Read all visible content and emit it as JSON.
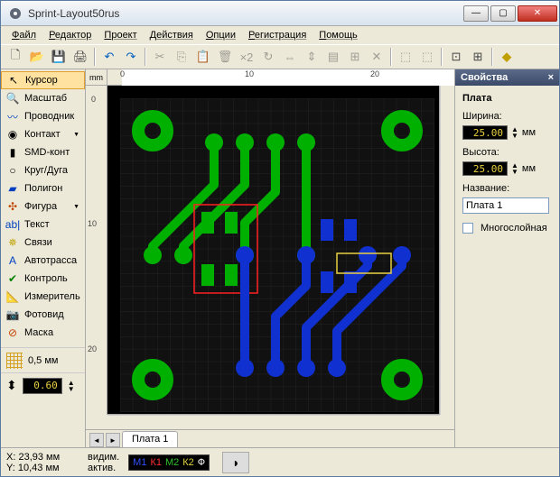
{
  "window": {
    "title": "Sprint-Layout50rus"
  },
  "menu": [
    "Файл",
    "Редактор",
    "Проект",
    "Действия",
    "Опции",
    "Регистрация",
    "Помощь"
  ],
  "tools": {
    "items": [
      {
        "icon": "↖",
        "label": "Курсор",
        "sel": true,
        "color": "#000"
      },
      {
        "icon": "🔍",
        "label": "Масштаб",
        "color": "#000"
      },
      {
        "icon": "〰",
        "label": "Проводник",
        "color": "#0040c0"
      },
      {
        "icon": "◉",
        "label": "Контакт",
        "color": "#000",
        "arrow": true
      },
      {
        "icon": "▮",
        "label": "SMD-конт",
        "color": "#000"
      },
      {
        "icon": "○",
        "label": "Круг/Дуга",
        "color": "#000"
      },
      {
        "icon": "▰",
        "label": "Полигон",
        "color": "#0040c0"
      },
      {
        "icon": "✣",
        "label": "Фигура",
        "color": "#c04000",
        "arrow": true
      },
      {
        "icon": "ab|",
        "label": "Текст",
        "color": "#0040c0"
      },
      {
        "icon": "✵",
        "label": "Связи",
        "color": "#c0a000"
      },
      {
        "icon": "A",
        "label": "Автотрасса",
        "color": "#0040c0"
      },
      {
        "icon": "✔",
        "label": "Контроль",
        "color": "#008000"
      },
      {
        "icon": "📐",
        "label": "Измеритель",
        "color": "#606060"
      },
      {
        "icon": "📷",
        "label": "Фотовид",
        "color": "#606060"
      },
      {
        "icon": "⊘",
        "label": "Маска",
        "color": "#c04000"
      }
    ],
    "grid_label": "0,5 мм",
    "track_width": "0.60"
  },
  "ruler": {
    "unit": "mm",
    "h": [
      "0",
      "10",
      "20"
    ],
    "v": [
      "0",
      "10",
      "20"
    ]
  },
  "tabs": {
    "board": "Плата 1"
  },
  "props": {
    "header": "Свойства",
    "title": "Плата",
    "width_label": "Ширина:",
    "width_val": "25.00",
    "height_label": "Высота:",
    "height_val": "25.00",
    "unit": "мм",
    "name_label": "Название:",
    "name_val": "Плата 1",
    "multilayer": "Многослойная"
  },
  "status": {
    "x_label": "X:",
    "x_val": "23,93 мм",
    "y_label": "Y:",
    "y_val": "10,43 мм",
    "visible": "видим.",
    "active": "актив.",
    "layers": [
      "M1",
      "К1",
      "М2",
      "К2",
      "Ф"
    ]
  }
}
